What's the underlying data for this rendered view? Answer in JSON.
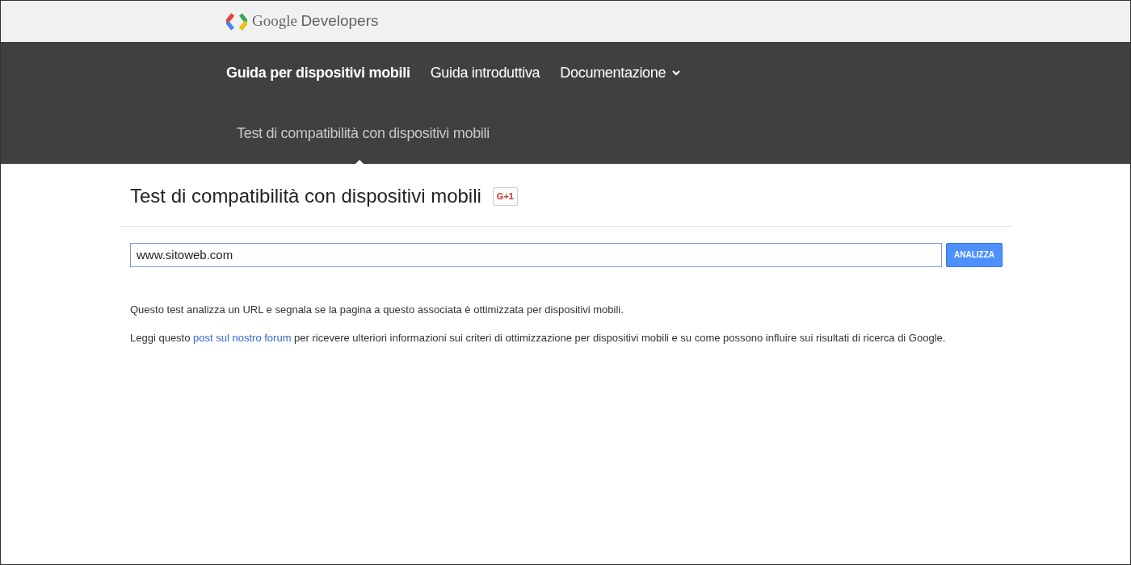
{
  "header": {
    "brand_google": "Google",
    "brand_product": "Developers"
  },
  "nav": [
    {
      "label": "Guida per dispositivi mobili",
      "selected": true,
      "dropdown": false
    },
    {
      "label": "Guida introduttiva",
      "selected": false,
      "dropdown": false
    },
    {
      "label": "Documentazione",
      "selected": false,
      "dropdown": true
    }
  ],
  "subnav": [
    {
      "label": "Test di compatibilità con dispositivi mobili",
      "selected": true
    }
  ],
  "page": {
    "title": "Test di compatibilità con dispositivi mobili",
    "share_badge": "G+1"
  },
  "form": {
    "url_value": "www.sitoweb.com",
    "button": "ANALIZZA"
  },
  "description": "Questo test analizza un URL e segnala se la pagina a questo associata è ottimizzata per dispositivi mobili.",
  "info": {
    "before": "Leggi questo ",
    "link": "post sul nostro forum",
    "after": " per ricevere ulteriori informazioni sui criteri di ottimizzazione per dispositivi mobili e su come possono influire sui risultati di ricerca di Google."
  }
}
